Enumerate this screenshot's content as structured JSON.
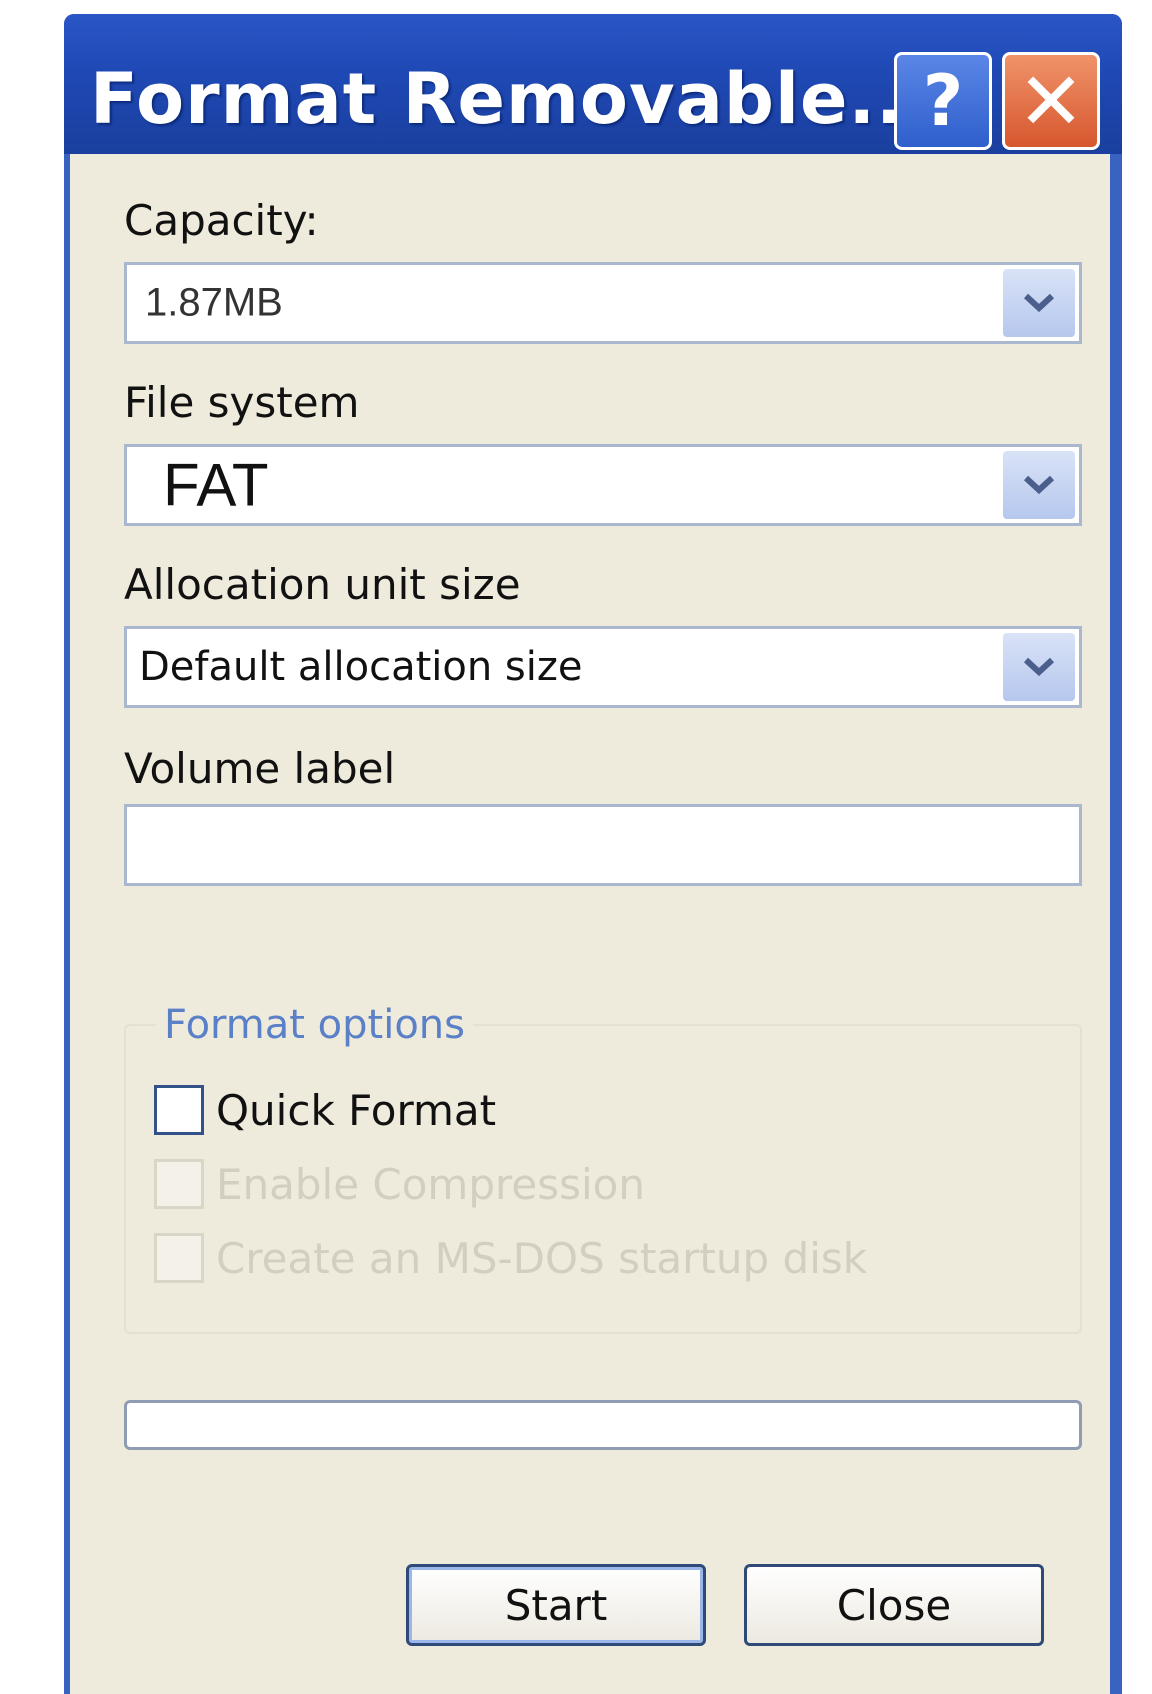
{
  "window": {
    "title": "Format Removable...",
    "help_glyph": "?",
    "close_glyph": "✕"
  },
  "capacity": {
    "label": "Capacity:",
    "value": "1.87MB"
  },
  "file_system": {
    "label": "File system",
    "value": "FAT"
  },
  "allocation": {
    "label": "Allocation unit size",
    "value": "Default allocation size"
  },
  "volume_label": {
    "label": "Volume label",
    "value": ""
  },
  "format_options": {
    "title": "Format options",
    "options": [
      {
        "label": "Quick Format",
        "checked": false,
        "enabled": true
      },
      {
        "label": "Enable Compression",
        "checked": false,
        "enabled": false
      },
      {
        "label": "Create an MS-DOS startup disk",
        "checked": false,
        "enabled": false
      }
    ]
  },
  "progress": {
    "fraction": 0
  },
  "buttons": {
    "start_label": "Start",
    "close_label": "Close"
  },
  "icons": {
    "help": "help-icon",
    "close": "close-icon",
    "dropdown": "chevron-down-icon"
  },
  "colors": {
    "titlebar": "#1f49b5",
    "close_button": "#d7572e",
    "client_background": "#efebdc",
    "group_title": "#5a80c8"
  }
}
